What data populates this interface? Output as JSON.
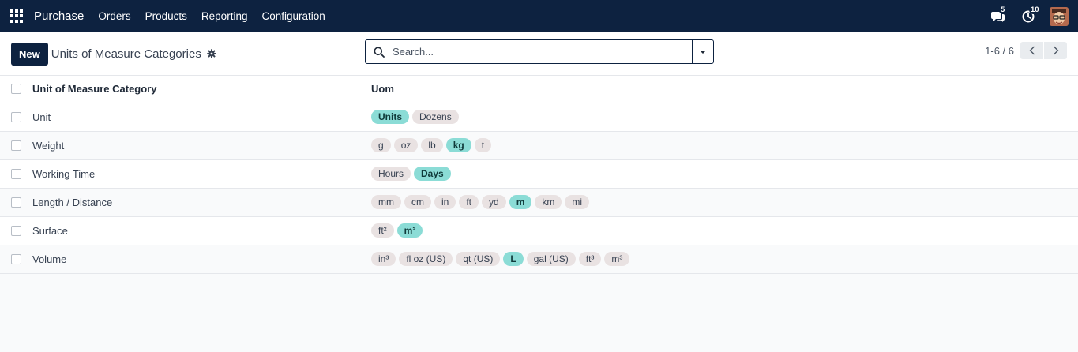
{
  "navbar": {
    "brand": "Purchase",
    "menu": [
      "Orders",
      "Products",
      "Reporting",
      "Configuration"
    ],
    "messages_count": "5",
    "activities_count": "10"
  },
  "control": {
    "new_label": "New",
    "title": "Units of Measure Categories",
    "search_placeholder": "Search...",
    "pager": "1-6 / 6"
  },
  "table": {
    "headers": [
      "Unit of Measure Category",
      "Uom"
    ],
    "rows": [
      {
        "name": "Unit",
        "uoms": [
          {
            "label": "Units",
            "ref": true
          },
          {
            "label": "Dozens",
            "ref": false
          }
        ]
      },
      {
        "name": "Weight",
        "uoms": [
          {
            "label": "g",
            "ref": false
          },
          {
            "label": "oz",
            "ref": false
          },
          {
            "label": "lb",
            "ref": false
          },
          {
            "label": "kg",
            "ref": true
          },
          {
            "label": "t",
            "ref": false
          }
        ]
      },
      {
        "name": "Working Time",
        "uoms": [
          {
            "label": "Hours",
            "ref": false
          },
          {
            "label": "Days",
            "ref": true
          }
        ]
      },
      {
        "name": "Length / Distance",
        "uoms": [
          {
            "label": "mm",
            "ref": false
          },
          {
            "label": "cm",
            "ref": false
          },
          {
            "label": "in",
            "ref": false
          },
          {
            "label": "ft",
            "ref": false
          },
          {
            "label": "yd",
            "ref": false
          },
          {
            "label": "m",
            "ref": true
          },
          {
            "label": "km",
            "ref": false
          },
          {
            "label": "mi",
            "ref": false
          }
        ]
      },
      {
        "name": "Surface",
        "uoms": [
          {
            "label": "ft²",
            "ref": false
          },
          {
            "label": "m²",
            "ref": true
          }
        ]
      },
      {
        "name": "Volume",
        "uoms": [
          {
            "label": "in³",
            "ref": false
          },
          {
            "label": "fl oz (US)",
            "ref": false
          },
          {
            "label": "qt (US)",
            "ref": false
          },
          {
            "label": "L",
            "ref": true
          },
          {
            "label": "gal (US)",
            "ref": false
          },
          {
            "label": "ft³",
            "ref": false
          },
          {
            "label": "m³",
            "ref": false
          }
        ]
      }
    ]
  },
  "colors": {
    "navbar_bg": "#0d2240",
    "reference_tag": "#8bdcd6",
    "tag": "#e9e2e2"
  }
}
